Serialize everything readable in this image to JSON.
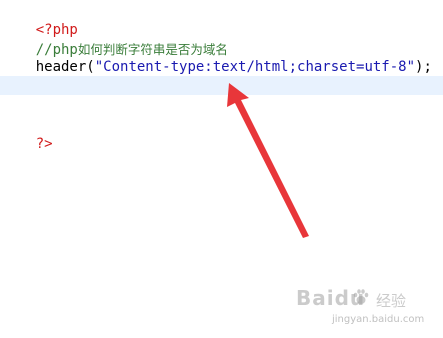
{
  "editor": {
    "lines": {
      "open_tag": "<?php",
      "comment_prefix": "//php",
      "comment_text": "如何判断字符串是否为域名",
      "header_func": "header",
      "header_paren_open": "(",
      "header_string": "\"Content-type:text/html;charset=utf-8\"",
      "header_paren_close": ");",
      "close_tag": "?>"
    }
  },
  "watermark": {
    "logo": "Baidu",
    "cn": "经验",
    "url": "jingyan.baidu.com"
  },
  "colors": {
    "php_tag": "#d11a1a",
    "comment": "#3a7d3a",
    "string": "#1a1ab0",
    "highlight_line": "#e8f2fe",
    "arrow": "#e8363a"
  }
}
